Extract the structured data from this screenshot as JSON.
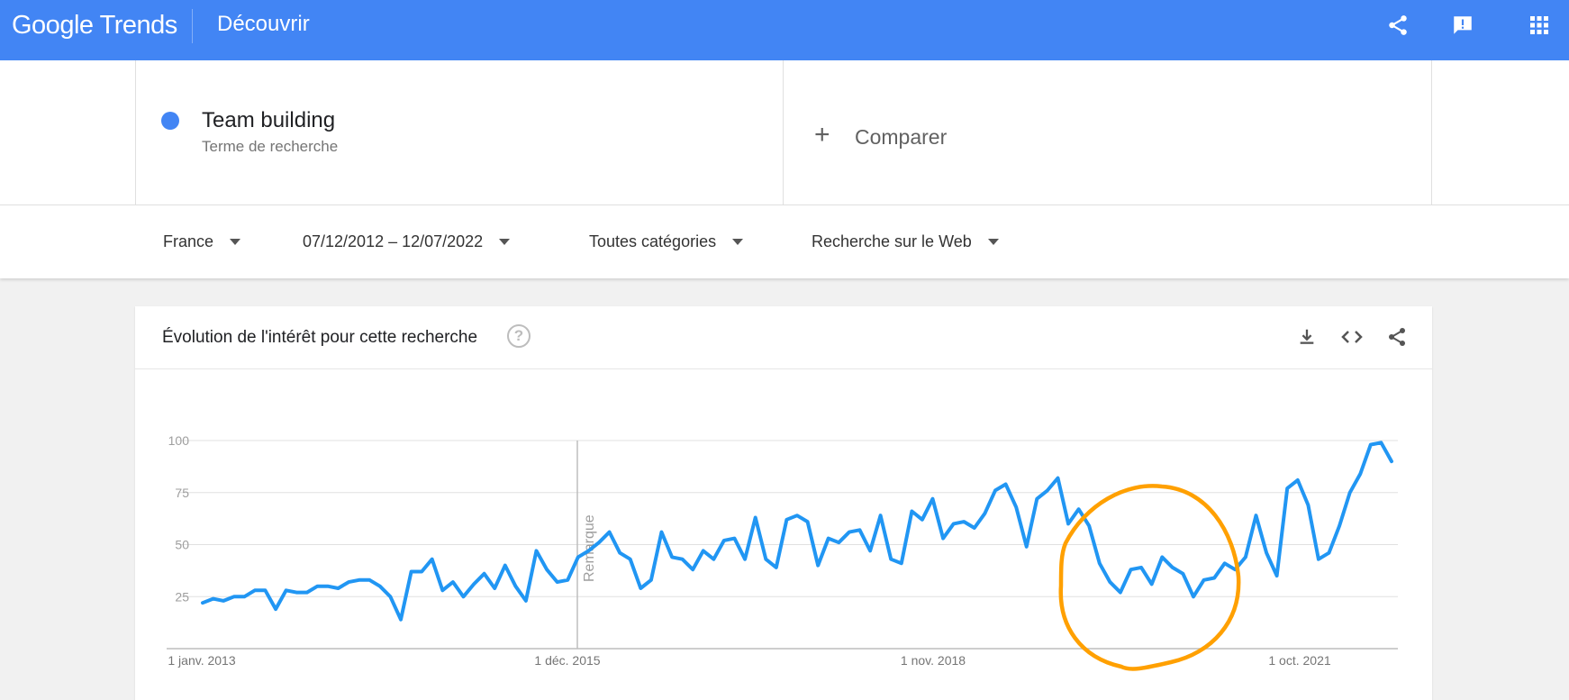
{
  "header": {
    "logo_google": "Google",
    "logo_trends": "Trends",
    "page_title": "Découvrir"
  },
  "search_term": {
    "name": "Team building",
    "subtitle": "Terme de recherche",
    "color": "#4285f4"
  },
  "compare": {
    "plus": "+",
    "label": "Comparer"
  },
  "filters": {
    "region": "France",
    "date_range": "07/12/2012 – 12/07/2022",
    "category": "Toutes catégories",
    "search_type": "Recherche sur le Web"
  },
  "card": {
    "title": "Évolution de l'intérêt pour cette recherche",
    "help": "?"
  },
  "icons": {
    "share": "share-icon",
    "feedback": "feedback-icon",
    "apps": "apps-icon",
    "download": "download-icon",
    "embed": "embed-icon",
    "card_share": "share-icon"
  },
  "colors": {
    "header": "#4285f4",
    "series": "#2196f3",
    "annotation_circle": "#ffa000"
  },
  "chart_data": {
    "type": "line",
    "title": "Évolution de l'intérêt pour cette recherche",
    "ylim": [
      0,
      100
    ],
    "yticks": [
      25,
      50,
      75,
      100
    ],
    "ytick_labels": [
      "25",
      "50",
      "75",
      "100"
    ],
    "xticks": [
      "1 janv. 2013",
      "1 déc. 2015",
      "1 nov. 2018",
      "1 oct. 2021"
    ],
    "grid": true,
    "marker_label": "Remarque",
    "series": [
      {
        "values": [
          22,
          24,
          23,
          25,
          25,
          28,
          28,
          19,
          28,
          27,
          27,
          30,
          30,
          29,
          32,
          33,
          33,
          30,
          25,
          14,
          37,
          37,
          43,
          28,
          32,
          25,
          31,
          36,
          29,
          40,
          30,
          23,
          47,
          38,
          32,
          33,
          44,
          47,
          51,
          56,
          46,
          43,
          29,
          33,
          56,
          44,
          43,
          38,
          47,
          43,
          52,
          53,
          43,
          63,
          43,
          39,
          62,
          64,
          61,
          40,
          53,
          51,
          56,
          57,
          47,
          64,
          43,
          41,
          66,
          62,
          72,
          53,
          60,
          61,
          58,
          65,
          76,
          79,
          68,
          49,
          72,
          76,
          82,
          60,
          67,
          59,
          41,
          32,
          27,
          38,
          39,
          31,
          44,
          39,
          36,
          25,
          33,
          34,
          41,
          38,
          44,
          64,
          46,
          35,
          77,
          81,
          69,
          43,
          46,
          59,
          75,
          84,
          98,
          99,
          90
        ]
      }
    ]
  }
}
